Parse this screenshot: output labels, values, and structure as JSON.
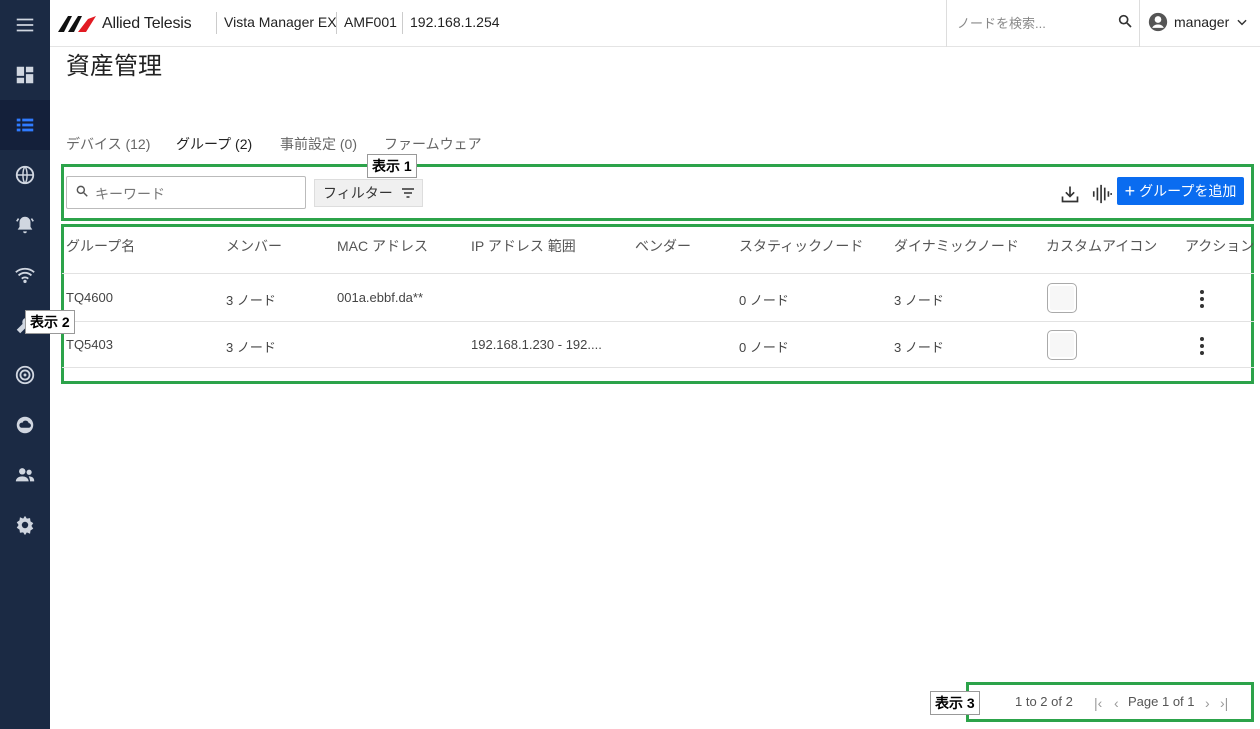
{
  "header": {
    "brand": "Allied Telesis",
    "product": "Vista Manager EX",
    "network": "AMF001",
    "ip": "192.168.1.254",
    "search_placeholder": "ノードを検索...",
    "user": "manager"
  },
  "sidebar": {
    "items": [
      {
        "icon": "menu-icon"
      },
      {
        "icon": "dashboard-icon"
      },
      {
        "icon": "asset-list-icon",
        "active": true
      },
      {
        "icon": "globe-icon"
      },
      {
        "icon": "alarm-icon"
      },
      {
        "icon": "wifi-icon"
      },
      {
        "icon": "tool-icon"
      },
      {
        "icon": "radar-icon"
      },
      {
        "icon": "cloud-icon"
      },
      {
        "icon": "users-icon"
      },
      {
        "icon": "settings-icon"
      }
    ]
  },
  "page": {
    "title": "資産管理",
    "tabs": [
      {
        "label": "デバイス (12)"
      },
      {
        "label": "グループ (2)",
        "active": true
      },
      {
        "label": "事前設定 (0)"
      },
      {
        "label": "ファームウェア"
      }
    ]
  },
  "toolbar": {
    "keyword_placeholder": "キーワード",
    "filter_label": "フィルター",
    "add_group_label": "グループを追加"
  },
  "callouts": {
    "c1": "表示 1",
    "c2": "表示 2",
    "c3": "表示 3"
  },
  "table": {
    "headers": [
      "グループ名",
      "メンバー",
      "MAC アドレス",
      "IP アドレス 範囲",
      "ベンダー",
      "スタティックノード",
      "ダイナミックノード",
      "カスタムアイコン",
      "アクション"
    ],
    "rows": [
      {
        "name": "TQ4600",
        "members": "3 ノード",
        "mac": "001a.ebbf.da**",
        "ip": "",
        "vendor": "",
        "static": "0 ノード",
        "dynamic": "3 ノード"
      },
      {
        "name": "TQ5403",
        "members": "3 ノード",
        "mac": "",
        "ip": "192.168.1.230 - 192....",
        "vendor": "",
        "static": "0 ノード",
        "dynamic": "3 ノード"
      }
    ]
  },
  "pagination": {
    "summary": "1 to 2 of 2",
    "page_label": "Page 1 of 1"
  },
  "colors": {
    "sidebar_bg": "#1b2a44",
    "accent": "#0a6cf0",
    "callout_border": "#2ca34a",
    "tab_underline": "#00a3c4"
  }
}
